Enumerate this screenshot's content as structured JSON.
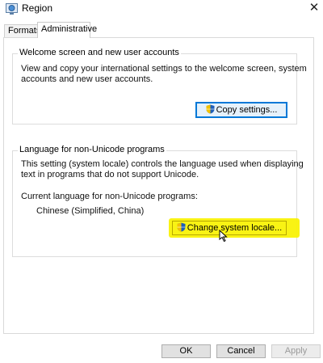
{
  "window": {
    "title": "Region",
    "close_glyph": "✕",
    "app_icon": "region-globe-icon"
  },
  "tabs": [
    {
      "label": "Formats",
      "selected": false
    },
    {
      "label": "Administrative",
      "selected": true
    }
  ],
  "welcome_group": {
    "title": "Welcome screen and new user accounts",
    "description_line1": "View and copy your international settings to the welcome screen, system",
    "description_line2": "accounts and new user accounts.",
    "copy_button_label": "Copy settings..."
  },
  "unicode_group": {
    "title": "Language for non-Unicode programs",
    "description_line1": "This setting (system locale) controls the language used when displaying",
    "description_line2": "text in programs that do not support Unicode.",
    "current_label": "Current language for non-Unicode programs:",
    "current_value": "Chinese (Simplified, China)",
    "change_button_label": "Change system locale..."
  },
  "footer": {
    "ok_label": "OK",
    "cancel_label": "Cancel",
    "apply_label": "Apply",
    "apply_enabled": false
  },
  "colors": {
    "focus_accent": "#0078d7",
    "highlight": "#f8f200",
    "shield_blue": "#1f5fb8",
    "shield_yellow": "#f2c200"
  }
}
